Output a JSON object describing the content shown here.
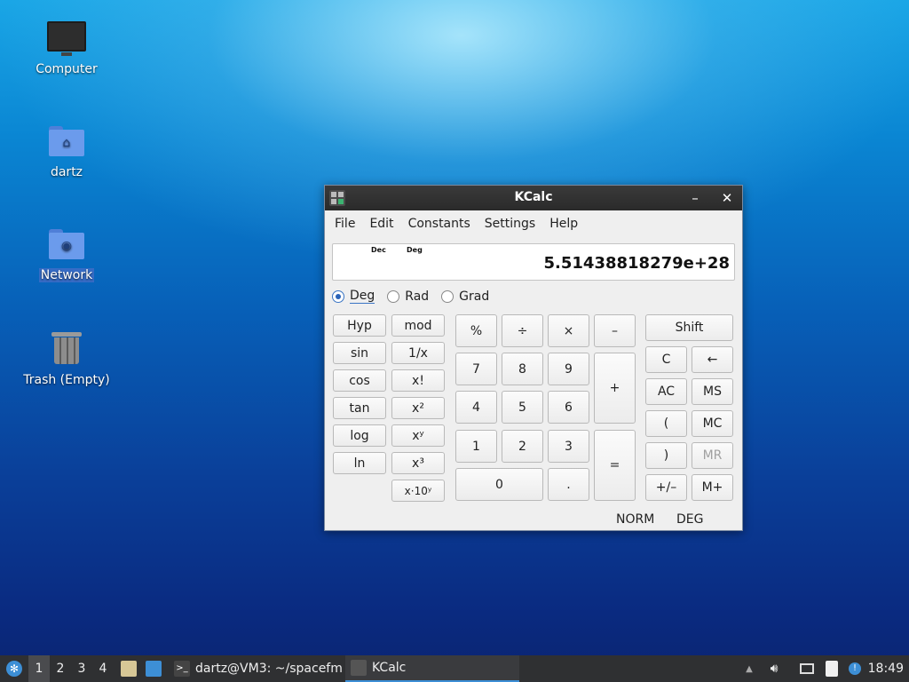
{
  "desktop": {
    "icons": [
      {
        "label": "Computer",
        "icon": "computer-icon"
      },
      {
        "label": "dartz",
        "icon": "home-folder-icon"
      },
      {
        "label": "Network",
        "icon": "network-folder-icon"
      },
      {
        "label": "Trash (Empty)",
        "icon": "trash-icon"
      }
    ]
  },
  "window": {
    "title": "KCalc",
    "minimize": "–",
    "close": "✕",
    "menu": [
      "File",
      "Edit",
      "Constants",
      "Settings",
      "Help"
    ],
    "display": {
      "base_indicator": "Dec",
      "angle_indicator": "Deg",
      "value": "5.51438818279e+28"
    },
    "angle_modes": [
      {
        "label": "Deg",
        "selected": true
      },
      {
        "label": "Rad",
        "selected": false
      },
      {
        "label": "Grad",
        "selected": false
      }
    ],
    "func_col1": [
      "Hyp",
      "sin",
      "cos",
      "tan",
      "log",
      "ln"
    ],
    "func_col2": [
      "mod",
      "1/x",
      "x!",
      "x²",
      "xʸ",
      "x³",
      "x·10ʸ"
    ],
    "operators": {
      "percent": "%",
      "divide": "÷",
      "multiply": "×",
      "minus": "–",
      "plus": "+",
      "equals": "=",
      "decimal": "."
    },
    "digits": {
      "d0": "0",
      "d1": "1",
      "d2": "2",
      "d3": "3",
      "d4": "4",
      "d5": "5",
      "d6": "6",
      "d7": "7",
      "d8": "8",
      "d9": "9"
    },
    "memory": {
      "shift": "Shift",
      "clear": "C",
      "backspace": "←",
      "all_clear": "AC",
      "ms": "MS",
      "open_paren": "(",
      "mc": "MC",
      "close_paren": ")",
      "mr": "MR",
      "plus_minus": "+/–",
      "m_plus": "M+"
    },
    "status": {
      "mode": "NORM",
      "angle": "DEG"
    }
  },
  "taskbar": {
    "workspaces": [
      "1",
      "2",
      "3",
      "4"
    ],
    "active_workspace": "1",
    "tasks": [
      {
        "label": "dartz@VM3: ~/spacefm",
        "icon": "terminal-icon"
      },
      {
        "label": "KCalc",
        "icon": "kcalc-icon",
        "active": true
      }
    ],
    "clock": "18:49"
  }
}
